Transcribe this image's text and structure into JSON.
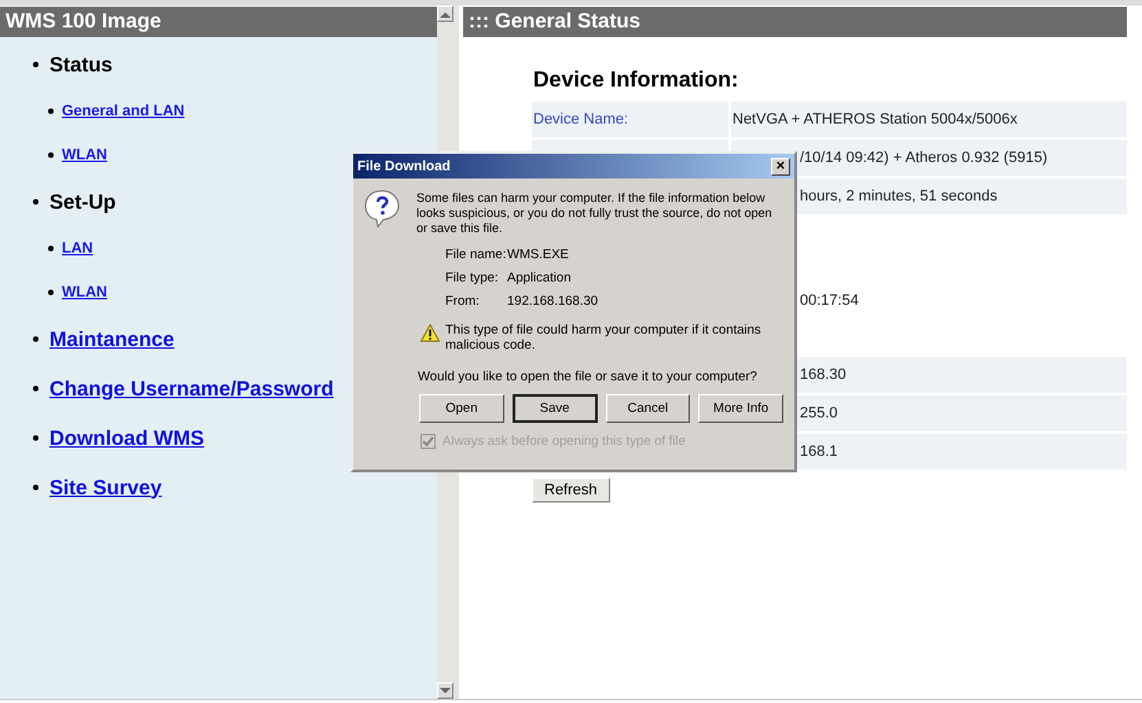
{
  "sidebar": {
    "title": "WMS 100 Image",
    "items": [
      {
        "label": "Status",
        "kind": "heading",
        "children": [
          {
            "label": "General and LAN"
          },
          {
            "label": "WLAN"
          }
        ]
      },
      {
        "label": "Set-Up",
        "kind": "heading",
        "children": [
          {
            "label": "LAN"
          },
          {
            "label": "WLAN"
          }
        ]
      },
      {
        "label": "Maintanence",
        "kind": "link"
      },
      {
        "label": "Change Username/Password",
        "kind": "link"
      },
      {
        "label": "Download WMS",
        "kind": "link"
      },
      {
        "label": "Site Survey",
        "kind": "link"
      }
    ]
  },
  "main": {
    "title": "::: General Status",
    "heading": "Device Information:",
    "rows": [
      {
        "kind": "shaded",
        "label": "Device Name:",
        "value": "NetVGA + ATHEROS Station 5004x/5006x"
      },
      {
        "kind": "shaded",
        "value": "/10/14 09:42) + Atheros 0.932 (5915)",
        "clipped": true
      },
      {
        "kind": "shaded",
        "value": "hours, 2 minutes, 51 seconds",
        "clipped": true
      },
      {
        "kind": "plain",
        "value": "00:17:54",
        "clipped": true
      },
      {
        "kind": "shaded",
        "value": "168.30",
        "clipped": true
      },
      {
        "kind": "shaded",
        "value": "255.0",
        "clipped": true
      },
      {
        "kind": "shaded",
        "value": "168.1",
        "clipped": true
      }
    ],
    "button": "Refresh"
  },
  "dialog": {
    "title": "File Download",
    "close": "×",
    "message": "Some files can harm your computer. If the file information below looks suspicious, or you do not fully trust the source, do not open or save this file.",
    "fields": [
      {
        "label": "File name:",
        "value": "WMS.EXE"
      },
      {
        "label": "File type:",
        "value": "Application"
      },
      {
        "label": "From:",
        "value": "192.168.168.30"
      }
    ],
    "warning": "This type of file could harm your computer if it contains malicious code.",
    "question": "Would you like to open the file or save it to your computer?",
    "buttons": [
      {
        "label": "Open",
        "selected": false
      },
      {
        "label": "Save",
        "selected": true
      },
      {
        "label": "Cancel",
        "selected": false
      },
      {
        "label": "More Info",
        "selected": false
      }
    ],
    "checkbox": {
      "label": "Always ask before opening this type of file",
      "checked": true,
      "disabled": true
    }
  }
}
